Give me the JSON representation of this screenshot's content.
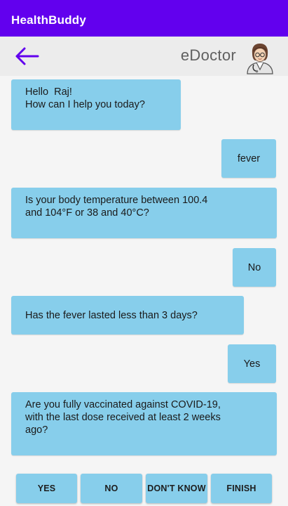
{
  "app_title": "HealthBuddy",
  "header": {
    "doctor_name": "eDoctor"
  },
  "colors": {
    "primary": "#6200ee",
    "bubble": "#87ceeb",
    "header_bg": "#ececec",
    "chat_bg": "#f5f5f5"
  },
  "icons": {
    "back": "arrow-left-icon",
    "avatar": "doctor-avatar-icon"
  },
  "messages": [
    {
      "sender": "bot",
      "lines": [
        "Hello  Raj!",
        "How can I help you today?"
      ]
    },
    {
      "sender": "user",
      "text": "fever"
    },
    {
      "sender": "bot",
      "lines": [
        "Is your body temperature between 100.4",
        "and 104°F or 38 and 40°C?"
      ]
    },
    {
      "sender": "user",
      "text": "No"
    },
    {
      "sender": "bot",
      "lines": [
        "Has the fever lasted less than 3 days?"
      ]
    },
    {
      "sender": "user",
      "text": "Yes"
    },
    {
      "sender": "bot",
      "lines": [
        "Are you fully vaccinated against COVID-19,",
        "with the last dose received at least 2 weeks",
        "ago?"
      ]
    }
  ],
  "buttons": [
    "YES",
    "NO",
    "DON'T KNOW",
    "FINISH"
  ]
}
